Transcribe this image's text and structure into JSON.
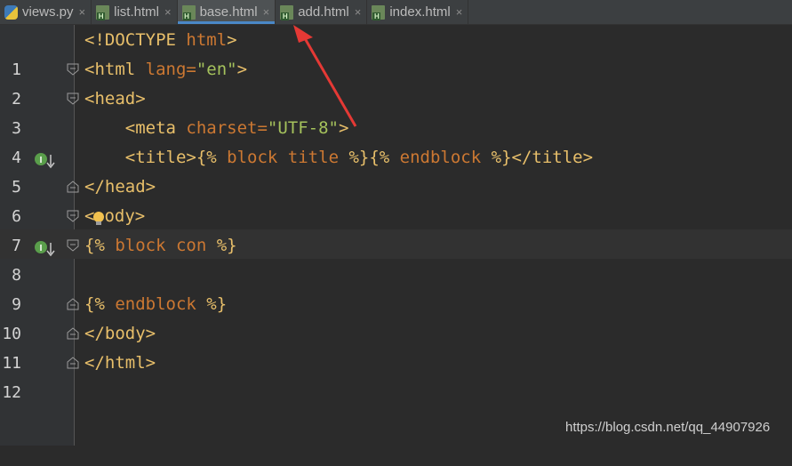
{
  "tabs": [
    {
      "label": "views.py",
      "icon": "python-file-icon",
      "active": false
    },
    {
      "label": "list.html",
      "icon": "html-file-icon",
      "active": false
    },
    {
      "label": "base.html",
      "icon": "html-file-icon",
      "active": true
    },
    {
      "label": "add.html",
      "icon": "html-file-icon",
      "active": false
    },
    {
      "label": "index.html",
      "icon": "html-file-icon",
      "active": false
    }
  ],
  "close_glyph": "×",
  "lines": [
    {
      "no": "1"
    },
    {
      "no": "2"
    },
    {
      "no": "3"
    },
    {
      "no": "4"
    },
    {
      "no": "5"
    },
    {
      "no": "6"
    },
    {
      "no": "7"
    },
    {
      "no": "8"
    },
    {
      "no": "9"
    },
    {
      "no": "10"
    },
    {
      "no": "11"
    },
    {
      "no": "12"
    }
  ],
  "code": {
    "l1_open": "<!DOCTYPE",
    "l1_attr": " html",
    "l1_close": ">",
    "l2_open": "<html",
    "l2_attr": " lang=",
    "l2_val": "\"en\"",
    "l2_close": ">",
    "l3": "<head>",
    "l4_open": "    <meta",
    "l4_attr": " charset=",
    "l4_val": "\"UTF-8\"",
    "l4_close": ">",
    "l5_open": "    <title>",
    "l5_tpl1": "{%",
    "l5_kw": " block title ",
    "l5_tpl2": "%}",
    "l5_tpl3": "{%",
    "l5_kw2": " endblock ",
    "l5_tpl4": "%}",
    "l5_close": "</title>",
    "l6": "</head>",
    "l7_a": "<",
    "l7_b": "ody>",
    "l8_tpl1": "{%",
    "l8_kw": " block con ",
    "l8_tpl2": "%}",
    "l10_tpl1": "{%",
    "l10_kw": " endblock ",
    "l10_tpl2": "%}",
    "l11": "</body>",
    "l12": "</html>"
  },
  "watermark": "https://blog.csdn.net/qq_44907926",
  "colors": {
    "background": "#2b2b2b",
    "tag": "#e8bf6a",
    "attribute": "#bababa",
    "string": "#a5c25c",
    "template_keyword": "#cc7832",
    "arrow": "#e53935"
  }
}
